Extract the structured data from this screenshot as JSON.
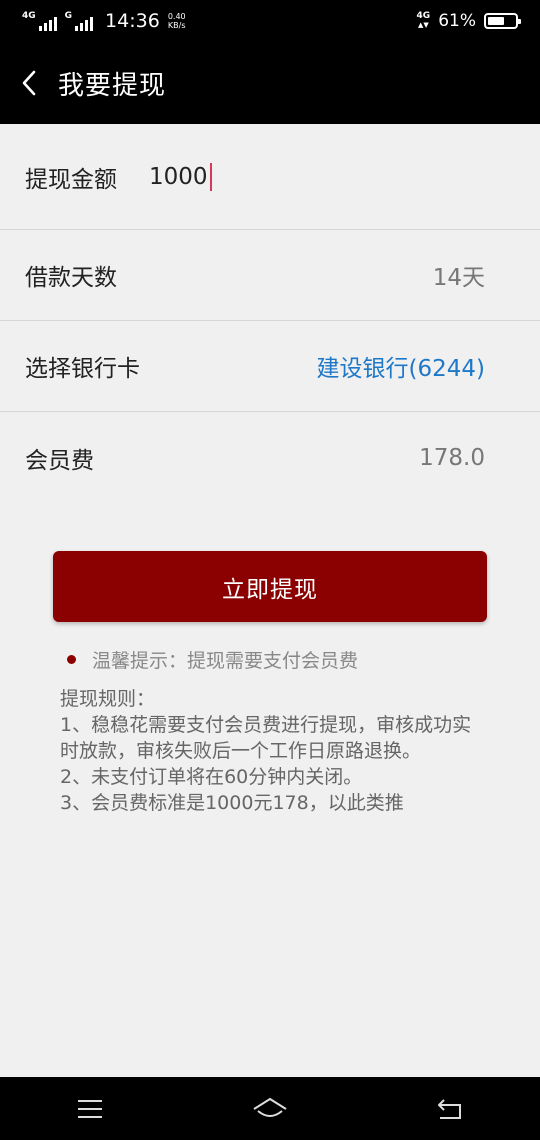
{
  "status_bar": {
    "net_left_1": "4G",
    "net_left_2": "G",
    "time": "14:36",
    "speed_value": "0.40",
    "speed_unit": "KB/s",
    "net_right": "4G",
    "battery_percent": "61%",
    "battery_level": 0.61
  },
  "app_bar": {
    "title": "我要提现",
    "back_icon": "chevron-left-icon"
  },
  "form": {
    "amount": {
      "label": "提现金额",
      "value": "1000"
    },
    "days": {
      "label": "借款天数",
      "value": "14天"
    },
    "bank": {
      "label": "选择银行卡",
      "value": "建设银行(6244)"
    },
    "fee": {
      "label": "会员费",
      "value": "178.0"
    }
  },
  "submit_label": "立即提现",
  "tip_text": "温馨提示：提现需要支付会员费",
  "rules": {
    "title": "提现规则：",
    "lines": [
      "1、稳稳花需要支付会员费进行提现，审核成功实时放款，审核失败后一个工作日原路退换。",
      "2、未支付订单将在60分钟内关闭。",
      "3、会员费标准是1000元178，以此类推"
    ]
  },
  "colors": {
    "accent": "#8b0000",
    "link": "#1e78c8",
    "caret": "#d63a5a"
  },
  "nav_bar": {
    "menu_icon": "menu-icon",
    "home_icon": "home-icon",
    "back_icon": "back-icon"
  }
}
